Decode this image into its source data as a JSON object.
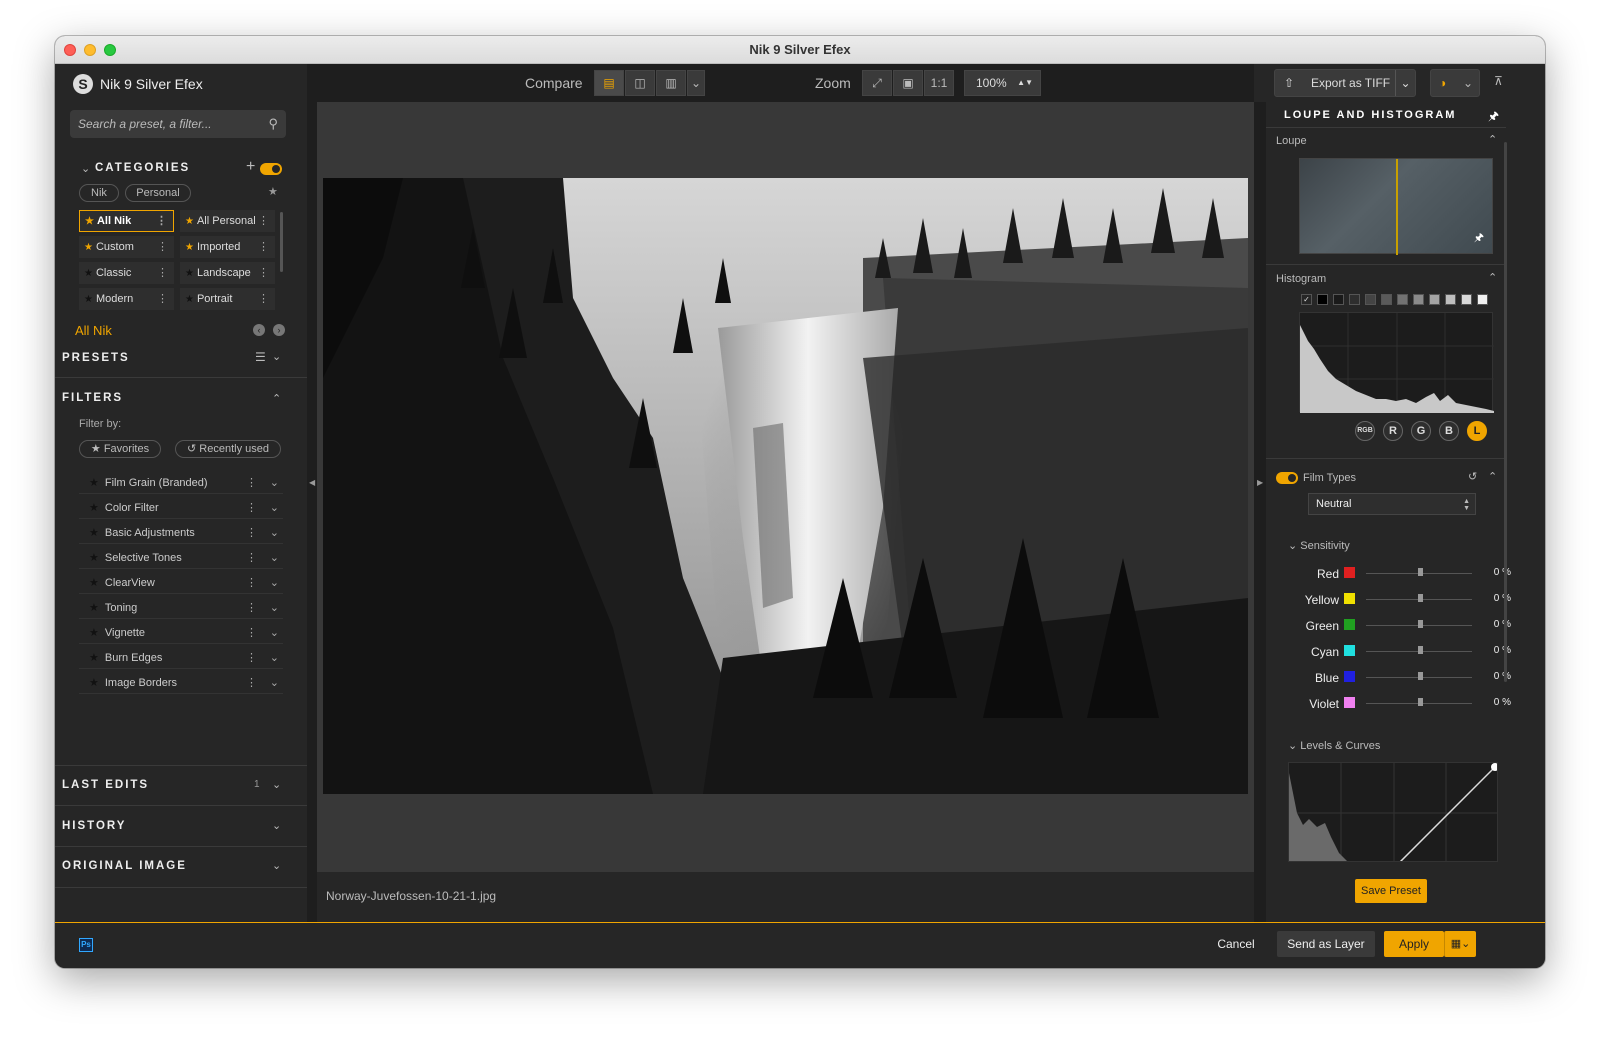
{
  "window": {
    "title": "Nik 9 Silver Efex"
  },
  "app": {
    "name": "Nik 9 Silver Efex",
    "logo_letter": "S"
  },
  "search": {
    "placeholder": "Search a preset, a filter..."
  },
  "categories": {
    "title": "CATEGORIES",
    "tabs": [
      "Nik",
      "Personal"
    ],
    "items": [
      {
        "label": "All Nik",
        "starred": true,
        "selected": true
      },
      {
        "label": "All Personal",
        "starred": true
      },
      {
        "label": "Custom",
        "starred": true
      },
      {
        "label": "Imported",
        "starred": true
      },
      {
        "label": "Classic",
        "starred": false
      },
      {
        "label": "Landscape",
        "starred": false
      },
      {
        "label": "Modern",
        "starred": false
      },
      {
        "label": "Portrait",
        "starred": false
      }
    ],
    "current": "All Nik"
  },
  "presets": {
    "title": "PRESETS"
  },
  "filters": {
    "title": "FILTERS",
    "filter_by": "Filter by:",
    "favorites": "Favorites",
    "recently_used": "Recently used",
    "items": [
      "Film Grain (Branded)",
      "Color Filter",
      "Basic Adjustments",
      "Selective Tones",
      "ClearView",
      "Toning",
      "Vignette",
      "Burn Edges",
      "Image Borders"
    ]
  },
  "last_edits": {
    "title": "LAST EDITS",
    "count": "1"
  },
  "history": {
    "title": "HISTORY"
  },
  "original_image": {
    "title": "ORIGINAL IMAGE"
  },
  "toolbar": {
    "compare_label": "Compare",
    "zoom_label": "Zoom",
    "zoom_one": "1:1",
    "zoom_value": "100%"
  },
  "canvas": {
    "filename": "Norway-Juvefossen-10-21-1.jpg"
  },
  "export": {
    "label": "Export as TIFF"
  },
  "loupe_histogram": {
    "title": "LOUPE AND HISTOGRAM",
    "loupe": "Loupe",
    "histogram": "Histogram",
    "channels": [
      "RGB",
      "R",
      "G",
      "B",
      "L"
    ],
    "active_channel": "L"
  },
  "film_types": {
    "label": "Film Types",
    "value": "Neutral"
  },
  "sensitivity": {
    "title": "Sensitivity",
    "items": [
      {
        "name": "Red",
        "color": "#e02020",
        "value": "0 %"
      },
      {
        "name": "Yellow",
        "color": "#f0e000",
        "value": "0 %"
      },
      {
        "name": "Green",
        "color": "#20a020",
        "value": "0 %"
      },
      {
        "name": "Cyan",
        "color": "#20e0e0",
        "value": "0 %"
      },
      {
        "name": "Blue",
        "color": "#2020e0",
        "value": "0 %"
      },
      {
        "name": "Violet",
        "color": "#f080f0",
        "value": "0 %"
      }
    ]
  },
  "levels_curves": {
    "title": "Levels & Curves"
  },
  "buttons": {
    "save_preset": "Save Preset",
    "cancel": "Cancel",
    "send_as_layer": "Send as Layer",
    "apply": "Apply"
  },
  "host": {
    "badge": "Ps"
  },
  "colors": {
    "accent": "#f0a500",
    "panel": "#262626",
    "dark": "#1e1e1e",
    "canvas": "#383838"
  }
}
